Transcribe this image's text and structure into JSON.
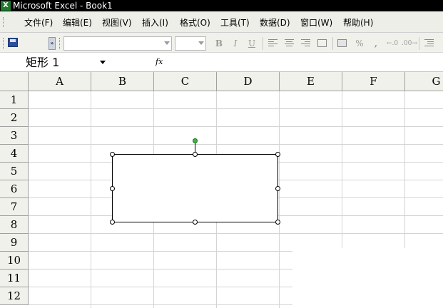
{
  "window": {
    "app_icon": "excel-icon",
    "title": "Microsoft Excel - Book1"
  },
  "menubar": {
    "items": [
      {
        "label": "文件(F)"
      },
      {
        "label": "编辑(E)"
      },
      {
        "label": "视图(V)"
      },
      {
        "label": "插入(I)"
      },
      {
        "label": "格式(O)"
      },
      {
        "label": "工具(T)"
      },
      {
        "label": "数据(D)"
      },
      {
        "label": "窗口(W)"
      },
      {
        "label": "帮助(H)"
      }
    ]
  },
  "toolbar": {
    "icons": [
      "save-icon",
      "bold-icon",
      "italic-icon",
      "underline-icon",
      "align-left-icon",
      "align-center-icon",
      "align-right-icon",
      "merge-center-icon",
      "currency-icon",
      "percent-icon",
      "comma-icon",
      "increase-decimal-icon",
      "decrease-decimal-icon",
      "indent-icon"
    ],
    "bold": "B",
    "italic": "I",
    "underline": "U",
    "percent": "%",
    "comma": ",",
    "font_name": "",
    "font_size": ""
  },
  "formula_bar": {
    "name_box": "矩形 1",
    "fx": "fx",
    "formula": ""
  },
  "sheet": {
    "columns": [
      "A",
      "B",
      "C",
      "D",
      "E",
      "F",
      "G"
    ],
    "rows": [
      "1",
      "2",
      "3",
      "4",
      "5",
      "6",
      "7",
      "8",
      "9",
      "10",
      "11",
      "12"
    ]
  },
  "colors": {
    "title_bar": "#000000",
    "menu_bg": "#eeeee9",
    "header_bg": "#f1f1ec",
    "gridline": "#d4d4d4",
    "rotation_handle": "#3dbb3d"
  }
}
